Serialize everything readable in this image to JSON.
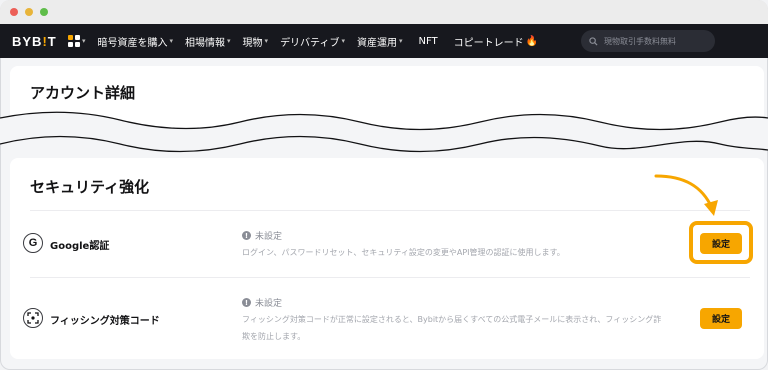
{
  "nav": {
    "logo_left": "BYB",
    "logo_bar": "!",
    "logo_right": "T",
    "items": [
      {
        "label": "暗号資産を購入",
        "caret": "▾"
      },
      {
        "label": "相場情報",
        "caret": "▾"
      },
      {
        "label": "現物",
        "caret": "▾"
      },
      {
        "label": "デリバティブ",
        "caret": "▾"
      },
      {
        "label": "資産運用",
        "caret": "▾"
      },
      {
        "label": "NFT",
        "caret": ""
      },
      {
        "label": "コピートレード",
        "caret": ""
      }
    ],
    "search_placeholder": "現物取引手数料無料"
  },
  "account": {
    "title": "アカウント詳細"
  },
  "security": {
    "title": "セキュリティ強化",
    "rows": [
      {
        "icon": "google-icon",
        "title": "Google認証",
        "status": "未設定",
        "description": "ログイン、パスワードリセット、セキュリティ設定の変更やAPI管理の認証に使用します。",
        "button": "設定"
      },
      {
        "icon": "anti-phishing-icon",
        "title": "フィッシング対策コード",
        "status": "未設定",
        "description_line1": "フィッシング対策コードが正常に設定されると、Bybitから届くすべての公式電子メールに表示され、フィッシング詐",
        "description_line2": "欺を防止します。",
        "button": "設定"
      }
    ]
  },
  "colors": {
    "accent": "#f7a600",
    "nav_bg": "#17181e",
    "page_bg": "#f4f5f7"
  }
}
